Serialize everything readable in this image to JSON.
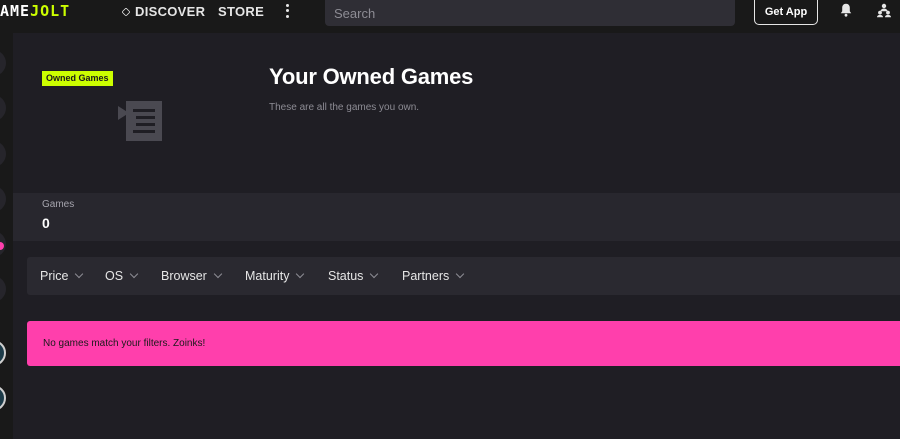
{
  "topbar": {
    "logo_text": "AME",
    "logo_accent": "JOLT",
    "nav_discover": "DISCOVER",
    "nav_store": "STORE",
    "search_placeholder": "Search",
    "get_app": "Get App",
    "icons": {
      "discover": "discover-icon",
      "more": "more-vertical-icon",
      "bell": "bell-icon",
      "friends": "friends-icon"
    }
  },
  "header": {
    "badge": "Owned Games",
    "title": "Your Owned Games",
    "subtitle": "These are all the games you own.",
    "thumb_icon": "game-list-icon"
  },
  "stats": {
    "label": "Games",
    "value": "0"
  },
  "filters": [
    {
      "label": "Price"
    },
    {
      "label": "OS"
    },
    {
      "label": "Browser"
    },
    {
      "label": "Maturity"
    },
    {
      "label": "Status"
    },
    {
      "label": "Partners"
    }
  ],
  "alert": {
    "message": "No games match your filters. Zoinks!"
  },
  "colors": {
    "accent_lime": "#ccff00",
    "accent_pink": "#ff3fac",
    "background": "#1f1e24",
    "topbar": "#191919"
  }
}
